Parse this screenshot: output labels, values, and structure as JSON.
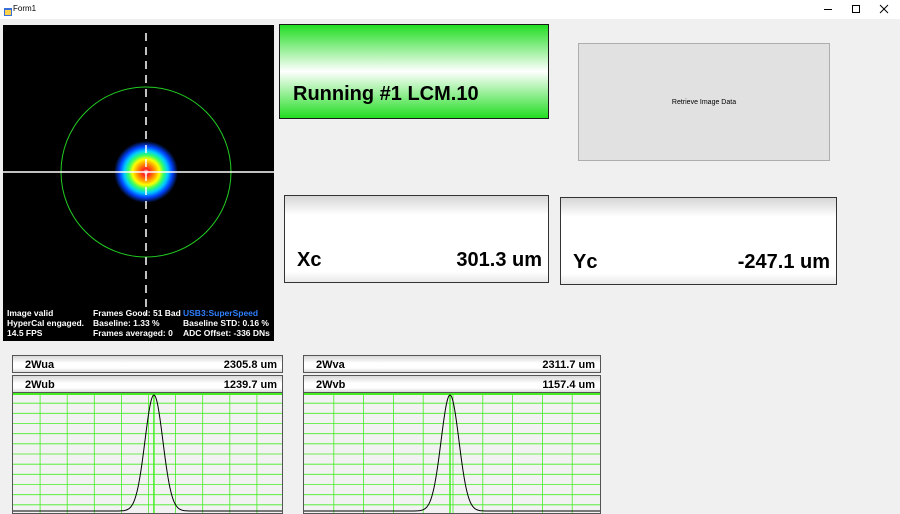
{
  "window": {
    "title": "Form1",
    "buttons": {
      "minimize": "minimize",
      "maximize": "maximize",
      "close": "close"
    }
  },
  "beam_image": {
    "status_lines": [
      "Image valid",
      "HyperCal engaged.",
      "14.5 FPS"
    ],
    "frame_lines": [
      "Frames Good: 51 Bad",
      "Baseline: 1.33 %",
      "Frames averaged: 0"
    ],
    "usb": "USB3:SuperSpeed",
    "stats_lines": [
      "Baseline STD:  0.16 %",
      "ADC Offset: -336 DNs"
    ],
    "colors": {
      "crosshair": "#ffffff",
      "ellipse": "#22cc22",
      "background": "#000000"
    }
  },
  "status": {
    "running_text": "Running #1 LCM.10",
    "color": "#22dd22"
  },
  "retrieve_button": {
    "label": "Retrieve Image Data"
  },
  "centroid": {
    "xc": {
      "label": "Xc",
      "value": "301.3 um"
    },
    "yc": {
      "label": "Yc",
      "value": "-247.1 um"
    }
  },
  "widths": {
    "ua": {
      "label": "2Wua",
      "value": "2305.8 um"
    },
    "ub": {
      "label": "2Wub",
      "value": "1239.7 um"
    },
    "va": {
      "label": "2Wva",
      "value": "2311.7 um"
    },
    "vb": {
      "label": "2Wvb",
      "value": "1157.4 um"
    }
  },
  "profiles": {
    "grid_color": "#44ee22",
    "curve_color": "#000000"
  }
}
